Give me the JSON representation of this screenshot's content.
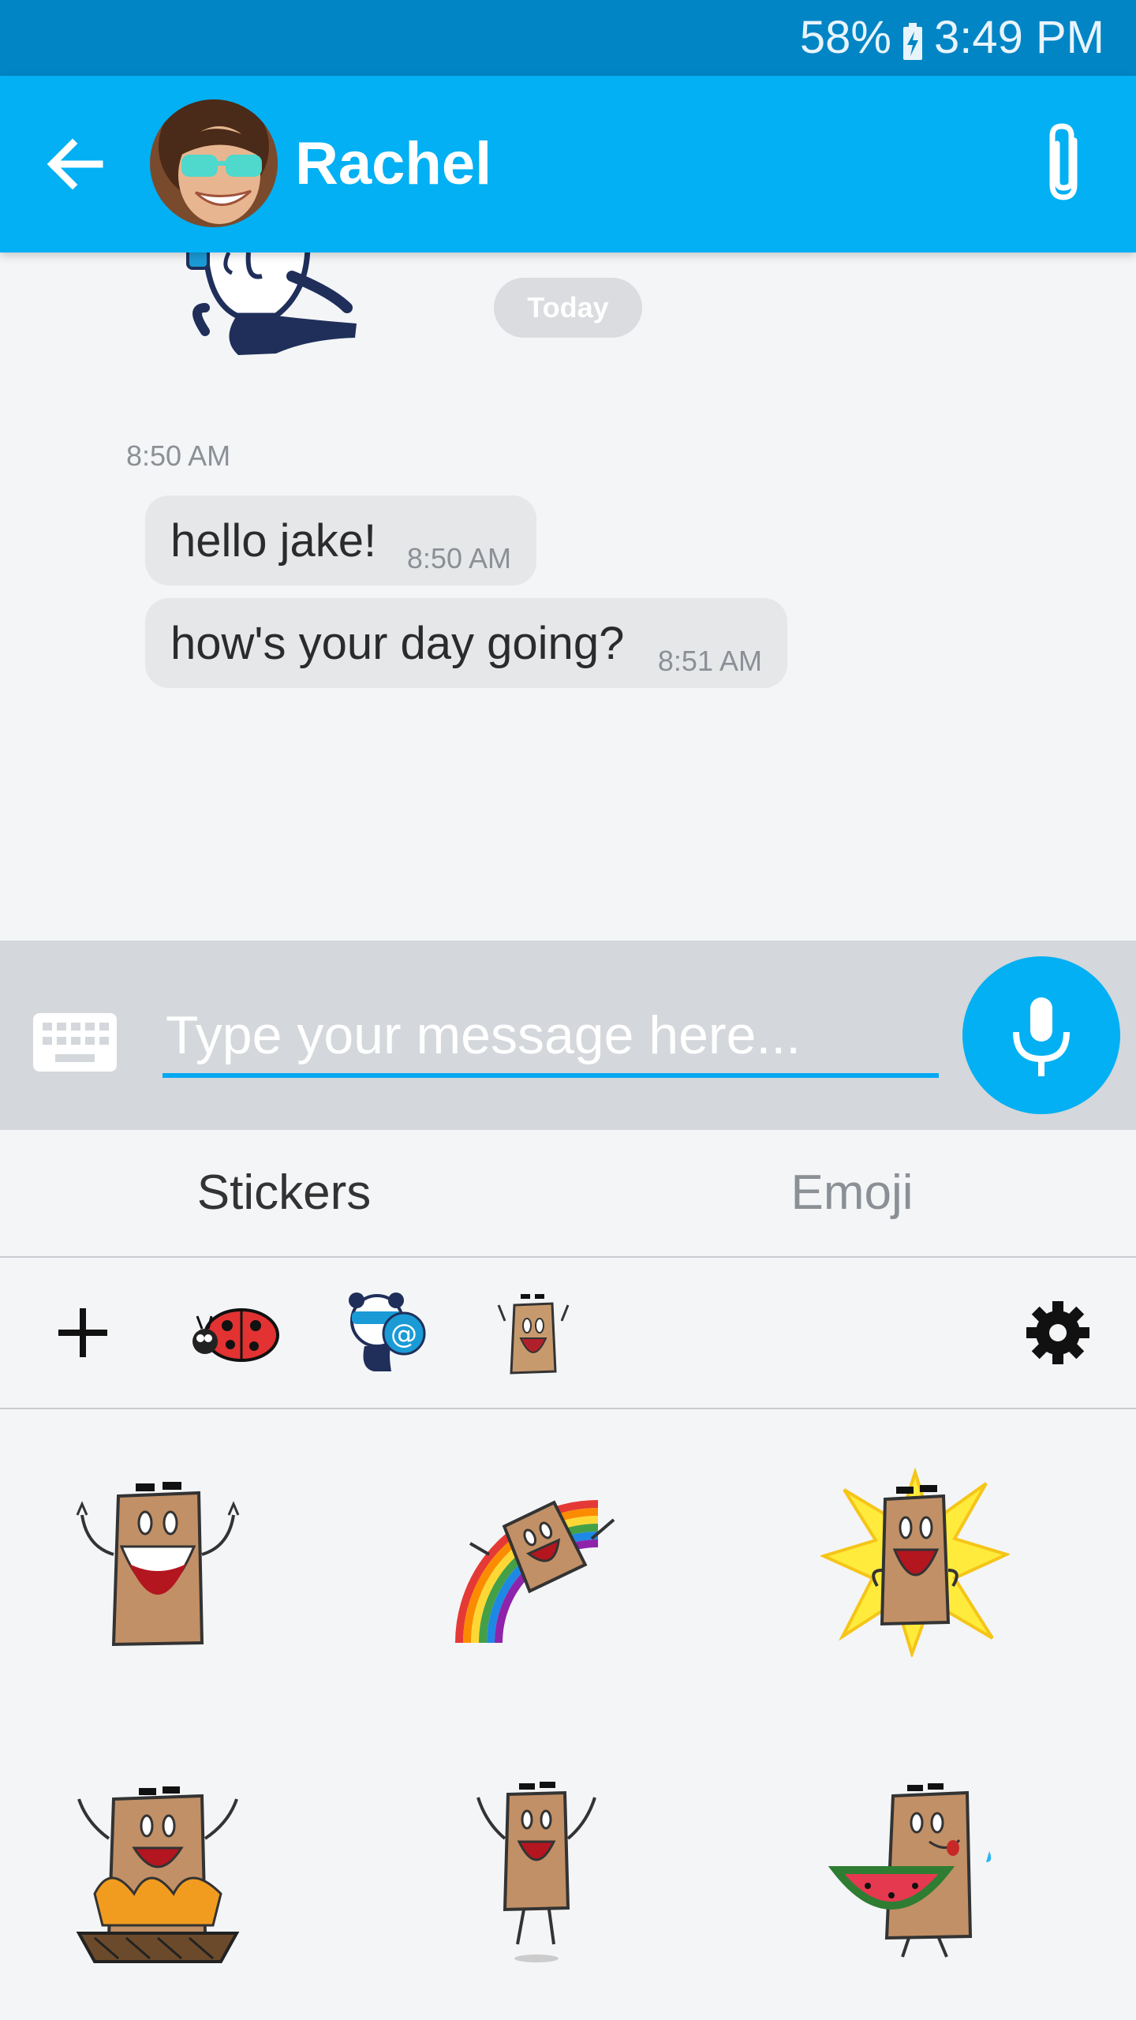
{
  "status_bar": {
    "battery": "58%",
    "time": "3:49 PM"
  },
  "header": {
    "contact_name": "Rachel"
  },
  "chat": {
    "date_label": "Today",
    "group_time": "8:50 AM",
    "messages": [
      {
        "text": "hello jake!",
        "time": "8:50 AM"
      },
      {
        "text": "how's your day going?",
        "time": "8:51 AM"
      }
    ]
  },
  "composer": {
    "placeholder": "Type your message here..."
  },
  "tabs": [
    {
      "label": "Stickers",
      "active": true
    },
    {
      "label": "Emoji",
      "active": false
    }
  ],
  "sticker_packs": [
    "ladybug-pack",
    "panda-pack",
    "paper-bag-pack"
  ],
  "stickers": [
    "bag-cheering",
    "bag-rainbow",
    "bag-starburst",
    "bag-campfire",
    "bag-jumping",
    "bag-watermelon"
  ],
  "colors": {
    "status_bar": "#0185c5",
    "app_bar": "#03b0f3",
    "accent": "#03a9f4",
    "bubble": "#e6e7e9"
  }
}
